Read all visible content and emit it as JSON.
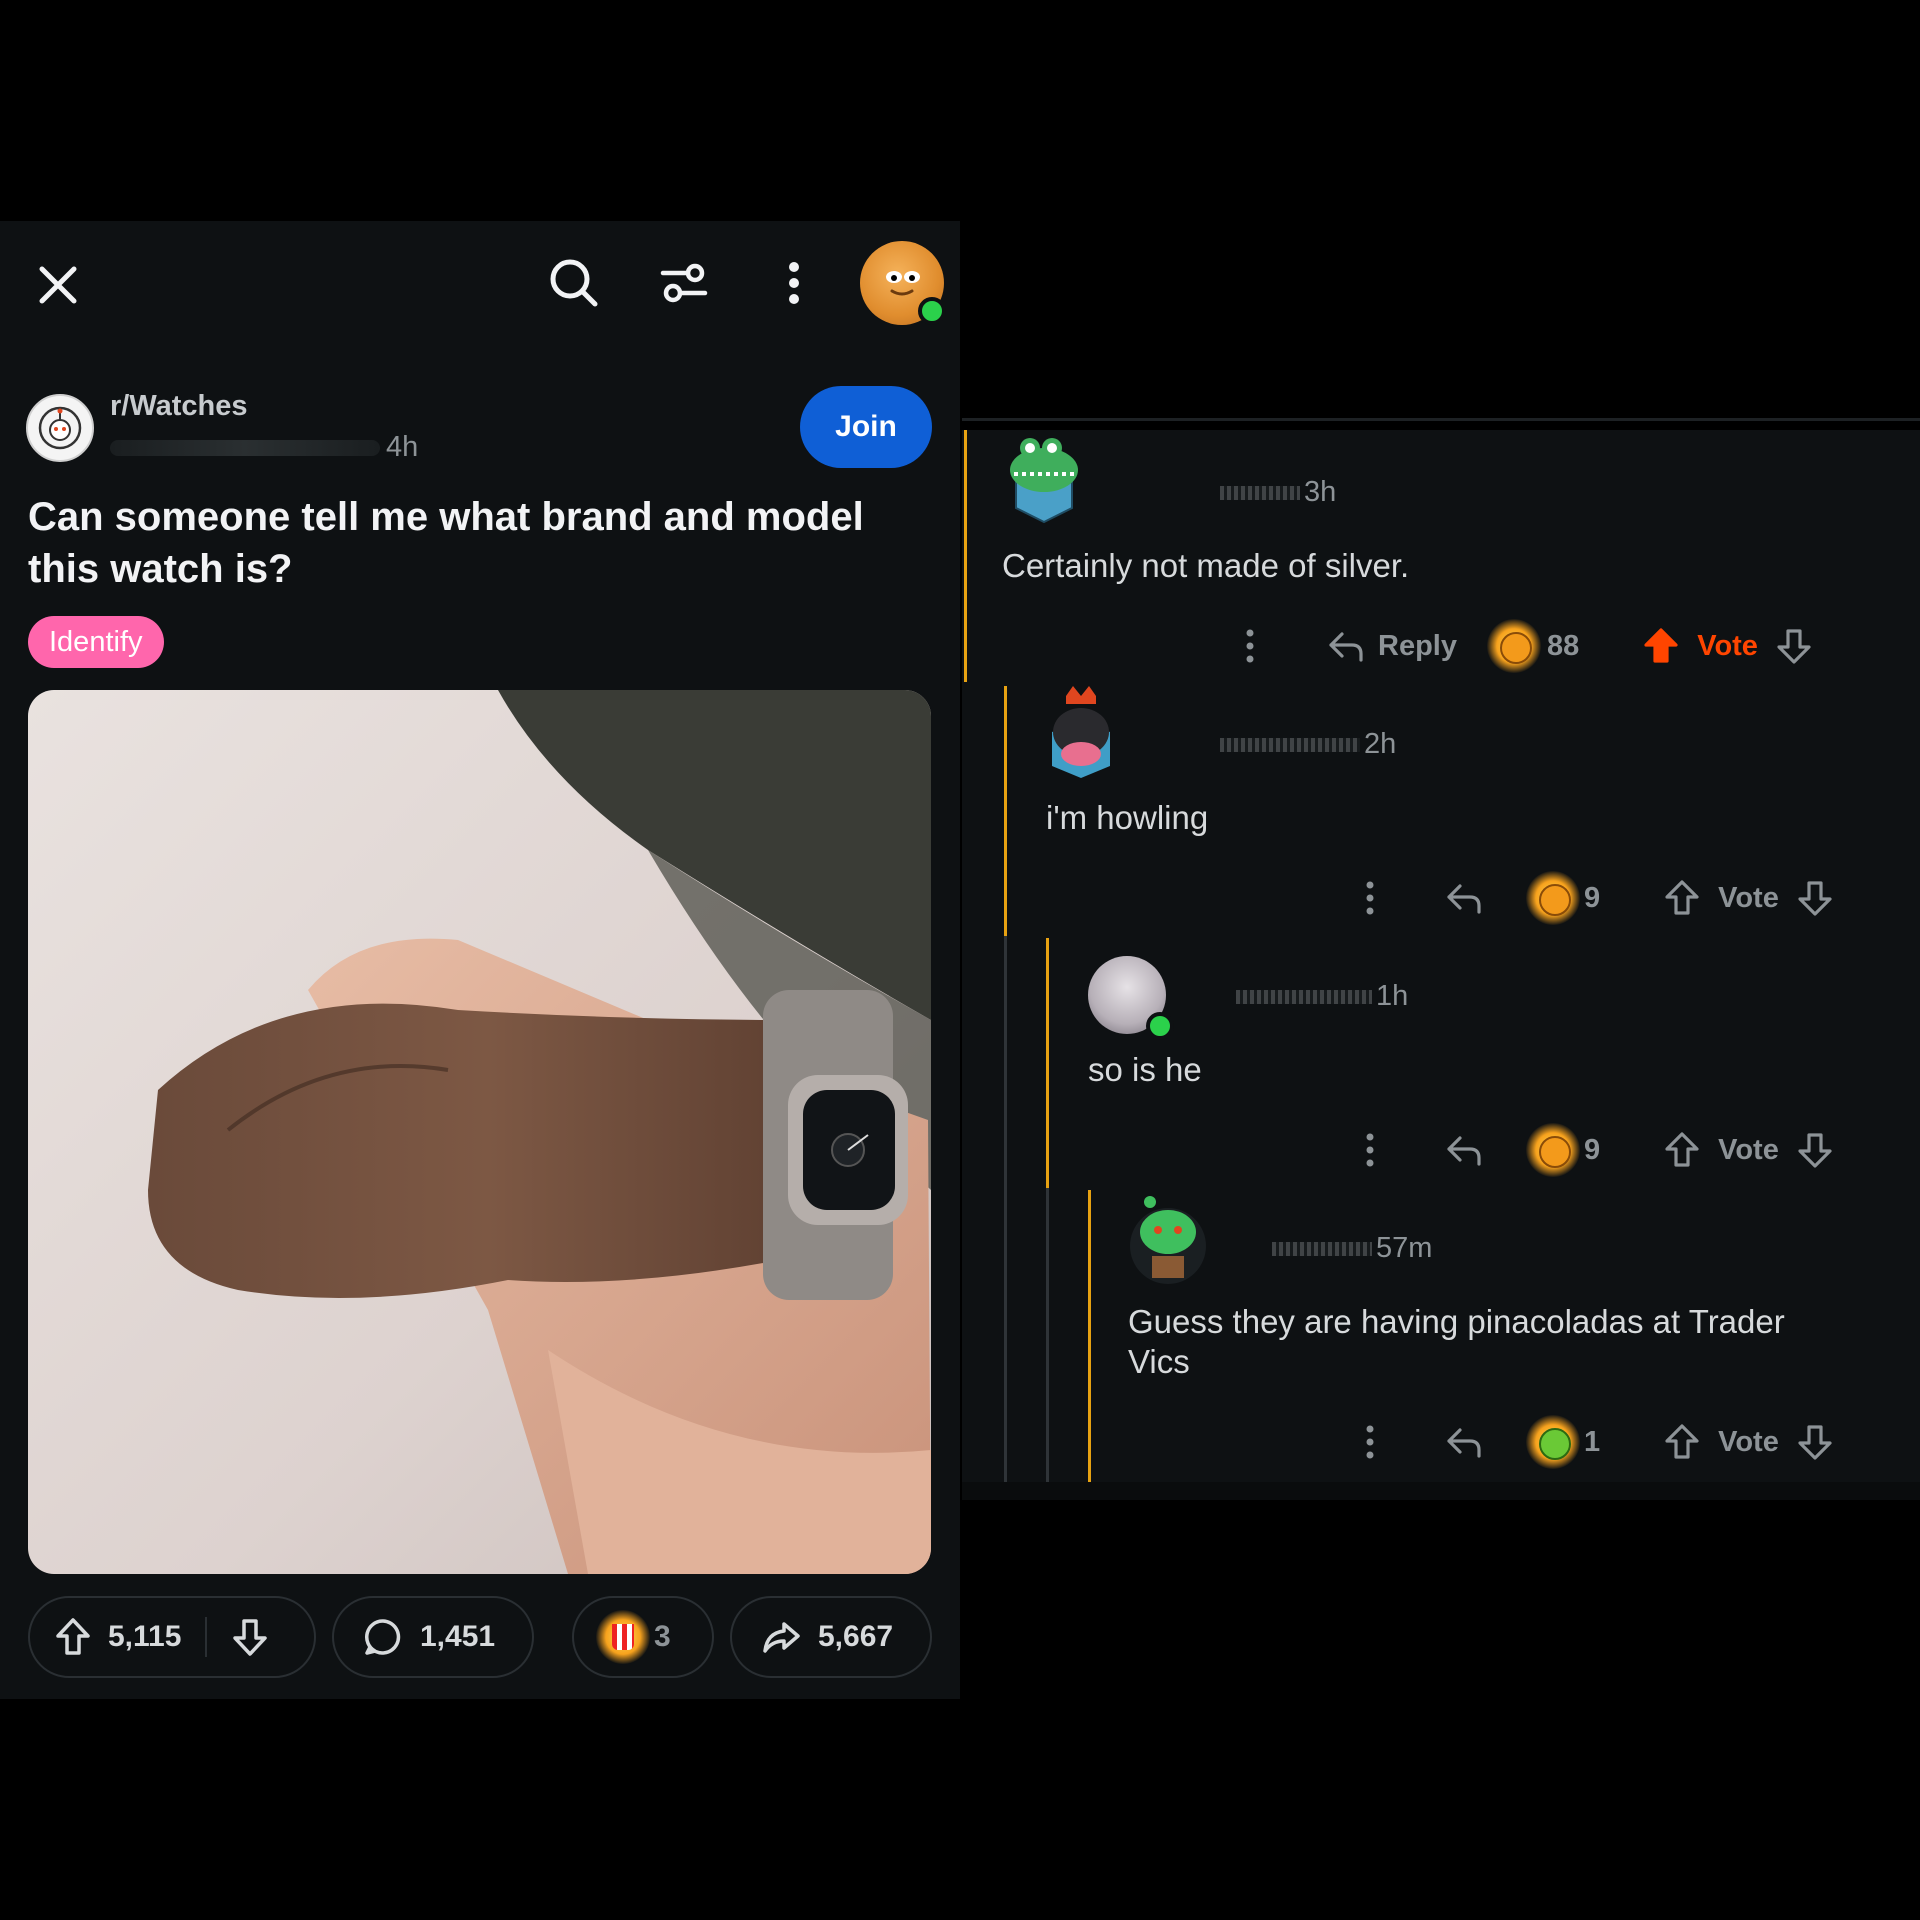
{
  "post": {
    "subreddit": "r/Watches",
    "time": "4h",
    "join_label": "Join",
    "title": "Can someone tell me what brand and model this watch is?",
    "flair": "Identify",
    "upvotes": "5,115",
    "comments": "1,451",
    "awards": "3",
    "shares": "5,667"
  },
  "comments": [
    {
      "time": "3h",
      "text": "Certainly not made of silver.",
      "reply_label": "Reply",
      "award_count": "88",
      "vote_label": "Vote"
    },
    {
      "time": "2h",
      "text": "i'm howling",
      "award_count": "9",
      "vote_label": "Vote"
    },
    {
      "time": "1h",
      "text": "so is he",
      "award_count": "9",
      "vote_label": "Vote"
    },
    {
      "time": "57m",
      "text": "Guess they are having pinacoladas at Trader Vics",
      "award_count": "1",
      "vote_label": "Vote"
    }
  ],
  "colors": {
    "join": "#0f5fd6",
    "flair": "#ff66ac",
    "thread": "#e7a212",
    "upvote_active": "#ff4500"
  }
}
